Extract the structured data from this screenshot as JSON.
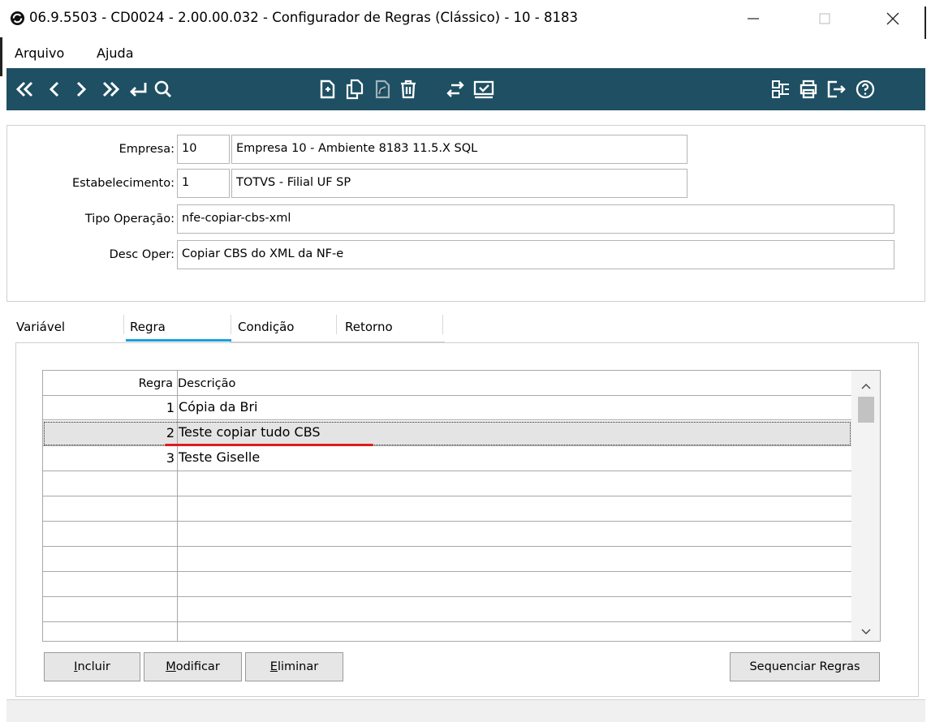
{
  "window": {
    "title": "06.9.5503 - CD0024 - 2.00.00.032 - Configurador de Regras (Clássico) - 10 - 8183",
    "icons": [
      "app-icon",
      "minimize-icon",
      "maximize-icon",
      "close-icon"
    ]
  },
  "menu": [
    {
      "label": "Arquivo"
    },
    {
      "label": "Ajuda"
    }
  ],
  "toolbar": {
    "background": "#1e4f63",
    "icon_color": "#ffffff",
    "buttons": [
      "first-record-icon",
      "previous-record-icon",
      "next-record-icon",
      "last-record-icon",
      "goto-icon",
      "search-icon",
      "new-document-icon",
      "copy-document-icon",
      "edit-document-icon",
      "delete-icon",
      "swap-icon",
      "confirm-icon",
      "settings-icon",
      "print-icon",
      "exit-icon",
      "help-icon"
    ]
  },
  "header": {
    "empresa": {
      "label": "Empresa:",
      "code": "10",
      "description": "Empresa 10 - Ambiente 8183 11.5.X SQL"
    },
    "estabelecimento": {
      "label": "Estabelecimento:",
      "code": "1",
      "description": "TOTVS - Filial UF SP"
    },
    "tipo_operacao": {
      "label": "Tipo Operação:",
      "value": "nfe-copiar-cbs-xml"
    },
    "desc_oper": {
      "label": "Desc Oper:",
      "value": "Copiar CBS do XML da NF-e"
    }
  },
  "tabs": [
    {
      "label": "Variável",
      "active": false
    },
    {
      "label": "Regra",
      "active": true
    },
    {
      "label": "Condição",
      "active": false
    },
    {
      "label": "Retorno",
      "active": false
    }
  ],
  "active_tab_color": "#1aa0db",
  "grid": {
    "columns": {
      "regra": "Regra",
      "descricao": "Descrição"
    },
    "rows": [
      {
        "regra": "1",
        "descricao": "Cópia da Bri"
      },
      {
        "regra": "2",
        "descricao": "Teste copiar tudo CBS"
      },
      {
        "regra": "3",
        "descricao": "Teste Giselle"
      }
    ],
    "selected_row": "2",
    "highlight_color": "#e11b1b"
  },
  "buttons": {
    "incluir": {
      "accel": "I",
      "rest": "ncluir"
    },
    "modificar": {
      "accel": "M",
      "rest": "odificar"
    },
    "eliminar": {
      "accel": "E",
      "rest": "liminar"
    },
    "sequenciar": "Sequenciar Regras"
  }
}
